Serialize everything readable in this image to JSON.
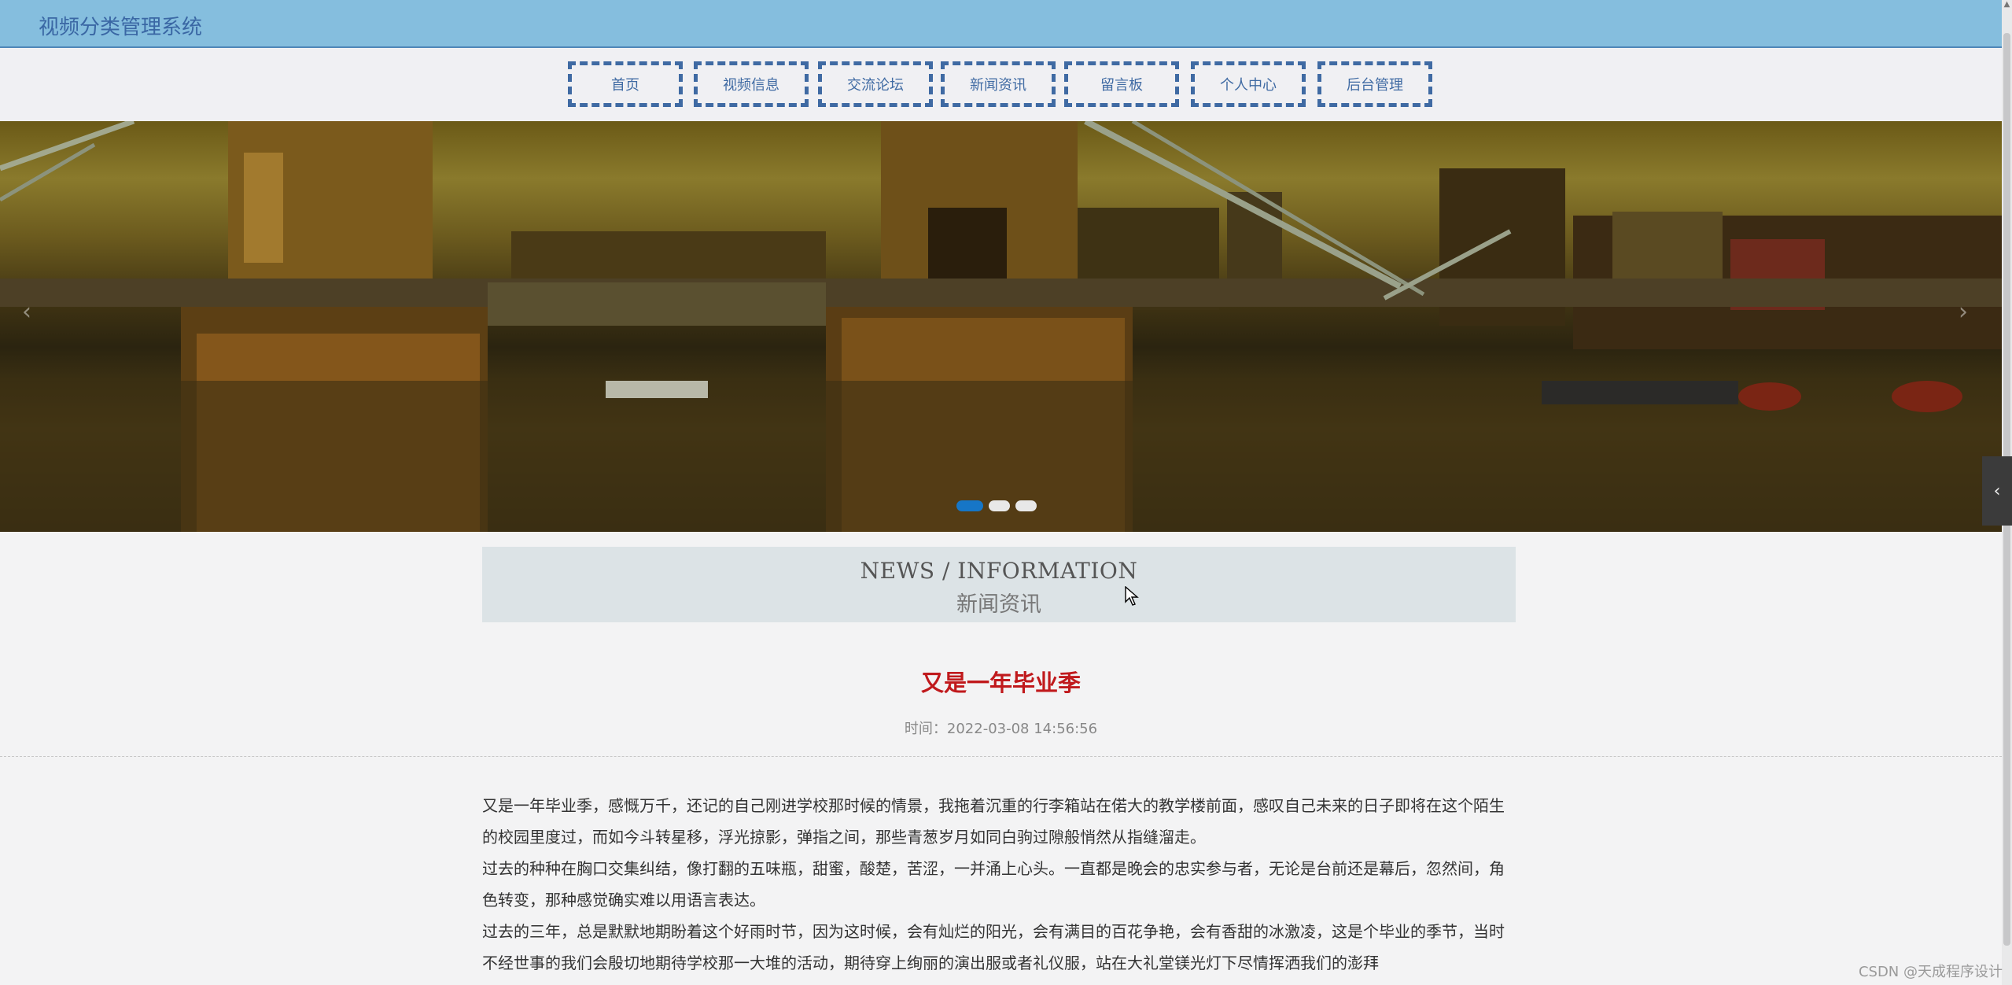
{
  "header": {
    "title": "视频分类管理系统"
  },
  "nav": {
    "items": [
      {
        "label": "首页"
      },
      {
        "label": "视频信息"
      },
      {
        "label": "交流论坛"
      },
      {
        "label": "新闻资讯"
      },
      {
        "label": "留言板"
      },
      {
        "label": "个人中心"
      },
      {
        "label": "后台管理"
      }
    ]
  },
  "banner": {
    "slide_count": 3,
    "active_slide": 1,
    "prev_icon": "‹",
    "next_icon": "›"
  },
  "section": {
    "title_en": "NEWS / INFORMATION",
    "title_cn": "新闻资讯"
  },
  "article": {
    "title": "又是一年毕业季",
    "time": "时间：2022-03-08 14:56:56",
    "paragraphs": [
      "又是一年毕业季，感慨万千，还记的自己刚进学校那时候的情景，我拖着沉重的行李箱站在偌大的教学楼前面，感叹自己未来的日子即将在这个陌生的校园里度过，而如今斗转星移，浮光掠影，弹指之间，那些青葱岁月如同白驹过隙般悄然从指缝溜走。",
      "过去的种种在胸口交集纠结，像打翻的五味瓶，甜蜜，酸楚，苦涩，一并涌上心头。一直都是晚会的忠实参与者，无论是台前还是幕后，忽然间，角色转变，那种感觉确实难以用语言表达。",
      "过去的三年，总是默默地期盼着这个好雨时节，因为这时候，会有灿烂的阳光，会有满目的百花争艳，会有香甜的冰激凌，这是个毕业的季节，当时不经世事的我们会殷切地期待学校那一大堆的活动，期待穿上绚丽的演出服或者礼仪服，站在大礼堂镁光灯下尽情挥洒我们的澎拜"
    ]
  },
  "side_tab": {
    "icon": "‹"
  },
  "watermark": "CSDN @天成程序设计"
}
